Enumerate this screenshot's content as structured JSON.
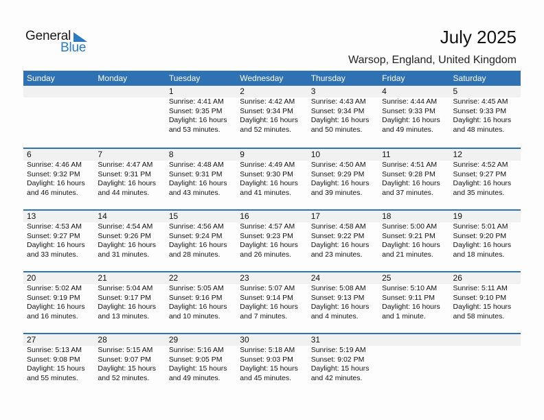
{
  "logo": {
    "word1": "General",
    "word2": "Blue"
  },
  "header": {
    "title": "July 2025",
    "location": "Warsop, England, United Kingdom"
  },
  "weekdays": [
    "Sunday",
    "Monday",
    "Tuesday",
    "Wednesday",
    "Thursday",
    "Friday",
    "Saturday"
  ],
  "weeks": [
    [
      {
        "day": "",
        "sunrise": "",
        "sunset": "",
        "daylight1": "",
        "daylight2": ""
      },
      {
        "day": "",
        "sunrise": "",
        "sunset": "",
        "daylight1": "",
        "daylight2": ""
      },
      {
        "day": "1",
        "sunrise": "Sunrise: 4:41 AM",
        "sunset": "Sunset: 9:35 PM",
        "daylight1": "Daylight: 16 hours",
        "daylight2": "and 53 minutes."
      },
      {
        "day": "2",
        "sunrise": "Sunrise: 4:42 AM",
        "sunset": "Sunset: 9:34 PM",
        "daylight1": "Daylight: 16 hours",
        "daylight2": "and 52 minutes."
      },
      {
        "day": "3",
        "sunrise": "Sunrise: 4:43 AM",
        "sunset": "Sunset: 9:34 PM",
        "daylight1": "Daylight: 16 hours",
        "daylight2": "and 50 minutes."
      },
      {
        "day": "4",
        "sunrise": "Sunrise: 4:44 AM",
        "sunset": "Sunset: 9:33 PM",
        "daylight1": "Daylight: 16 hours",
        "daylight2": "and 49 minutes."
      },
      {
        "day": "5",
        "sunrise": "Sunrise: 4:45 AM",
        "sunset": "Sunset: 9:33 PM",
        "daylight1": "Daylight: 16 hours",
        "daylight2": "and 48 minutes."
      }
    ],
    [
      {
        "day": "6",
        "sunrise": "Sunrise: 4:46 AM",
        "sunset": "Sunset: 9:32 PM",
        "daylight1": "Daylight: 16 hours",
        "daylight2": "and 46 minutes."
      },
      {
        "day": "7",
        "sunrise": "Sunrise: 4:47 AM",
        "sunset": "Sunset: 9:31 PM",
        "daylight1": "Daylight: 16 hours",
        "daylight2": "and 44 minutes."
      },
      {
        "day": "8",
        "sunrise": "Sunrise: 4:48 AM",
        "sunset": "Sunset: 9:31 PM",
        "daylight1": "Daylight: 16 hours",
        "daylight2": "and 43 minutes."
      },
      {
        "day": "9",
        "sunrise": "Sunrise: 4:49 AM",
        "sunset": "Sunset: 9:30 PM",
        "daylight1": "Daylight: 16 hours",
        "daylight2": "and 41 minutes."
      },
      {
        "day": "10",
        "sunrise": "Sunrise: 4:50 AM",
        "sunset": "Sunset: 9:29 PM",
        "daylight1": "Daylight: 16 hours",
        "daylight2": "and 39 minutes."
      },
      {
        "day": "11",
        "sunrise": "Sunrise: 4:51 AM",
        "sunset": "Sunset: 9:28 PM",
        "daylight1": "Daylight: 16 hours",
        "daylight2": "and 37 minutes."
      },
      {
        "day": "12",
        "sunrise": "Sunrise: 4:52 AM",
        "sunset": "Sunset: 9:27 PM",
        "daylight1": "Daylight: 16 hours",
        "daylight2": "and 35 minutes."
      }
    ],
    [
      {
        "day": "13",
        "sunrise": "Sunrise: 4:53 AM",
        "sunset": "Sunset: 9:27 PM",
        "daylight1": "Daylight: 16 hours",
        "daylight2": "and 33 minutes."
      },
      {
        "day": "14",
        "sunrise": "Sunrise: 4:54 AM",
        "sunset": "Sunset: 9:26 PM",
        "daylight1": "Daylight: 16 hours",
        "daylight2": "and 31 minutes."
      },
      {
        "day": "15",
        "sunrise": "Sunrise: 4:56 AM",
        "sunset": "Sunset: 9:24 PM",
        "daylight1": "Daylight: 16 hours",
        "daylight2": "and 28 minutes."
      },
      {
        "day": "16",
        "sunrise": "Sunrise: 4:57 AM",
        "sunset": "Sunset: 9:23 PM",
        "daylight1": "Daylight: 16 hours",
        "daylight2": "and 26 minutes."
      },
      {
        "day": "17",
        "sunrise": "Sunrise: 4:58 AM",
        "sunset": "Sunset: 9:22 PM",
        "daylight1": "Daylight: 16 hours",
        "daylight2": "and 23 minutes."
      },
      {
        "day": "18",
        "sunrise": "Sunrise: 5:00 AM",
        "sunset": "Sunset: 9:21 PM",
        "daylight1": "Daylight: 16 hours",
        "daylight2": "and 21 minutes."
      },
      {
        "day": "19",
        "sunrise": "Sunrise: 5:01 AM",
        "sunset": "Sunset: 9:20 PM",
        "daylight1": "Daylight: 16 hours",
        "daylight2": "and 18 minutes."
      }
    ],
    [
      {
        "day": "20",
        "sunrise": "Sunrise: 5:02 AM",
        "sunset": "Sunset: 9:19 PM",
        "daylight1": "Daylight: 16 hours",
        "daylight2": "and 16 minutes."
      },
      {
        "day": "21",
        "sunrise": "Sunrise: 5:04 AM",
        "sunset": "Sunset: 9:17 PM",
        "daylight1": "Daylight: 16 hours",
        "daylight2": "and 13 minutes."
      },
      {
        "day": "22",
        "sunrise": "Sunrise: 5:05 AM",
        "sunset": "Sunset: 9:16 PM",
        "daylight1": "Daylight: 16 hours",
        "daylight2": "and 10 minutes."
      },
      {
        "day": "23",
        "sunrise": "Sunrise: 5:07 AM",
        "sunset": "Sunset: 9:14 PM",
        "daylight1": "Daylight: 16 hours",
        "daylight2": "and 7 minutes."
      },
      {
        "day": "24",
        "sunrise": "Sunrise: 5:08 AM",
        "sunset": "Sunset: 9:13 PM",
        "daylight1": "Daylight: 16 hours",
        "daylight2": "and 4 minutes."
      },
      {
        "day": "25",
        "sunrise": "Sunrise: 5:10 AM",
        "sunset": "Sunset: 9:11 PM",
        "daylight1": "Daylight: 16 hours",
        "daylight2": "and 1 minute."
      },
      {
        "day": "26",
        "sunrise": "Sunrise: 5:11 AM",
        "sunset": "Sunset: 9:10 PM",
        "daylight1": "Daylight: 15 hours",
        "daylight2": "and 58 minutes."
      }
    ],
    [
      {
        "day": "27",
        "sunrise": "Sunrise: 5:13 AM",
        "sunset": "Sunset: 9:08 PM",
        "daylight1": "Daylight: 15 hours",
        "daylight2": "and 55 minutes."
      },
      {
        "day": "28",
        "sunrise": "Sunrise: 5:15 AM",
        "sunset": "Sunset: 9:07 PM",
        "daylight1": "Daylight: 15 hours",
        "daylight2": "and 52 minutes."
      },
      {
        "day": "29",
        "sunrise": "Sunrise: 5:16 AM",
        "sunset": "Sunset: 9:05 PM",
        "daylight1": "Daylight: 15 hours",
        "daylight2": "and 49 minutes."
      },
      {
        "day": "30",
        "sunrise": "Sunrise: 5:18 AM",
        "sunset": "Sunset: 9:03 PM",
        "daylight1": "Daylight: 15 hours",
        "daylight2": "and 45 minutes."
      },
      {
        "day": "31",
        "sunrise": "Sunrise: 5:19 AM",
        "sunset": "Sunset: 9:02 PM",
        "daylight1": "Daylight: 15 hours",
        "daylight2": "and 42 minutes."
      },
      {
        "day": "",
        "sunrise": "",
        "sunset": "",
        "daylight1": "",
        "daylight2": ""
      },
      {
        "day": "",
        "sunrise": "",
        "sunset": "",
        "daylight1": "",
        "daylight2": ""
      }
    ]
  ],
  "colors": {
    "accent": "#2e72b4",
    "logo_blue": "#2a7bc2",
    "day_strip": "#f1f1f1"
  }
}
